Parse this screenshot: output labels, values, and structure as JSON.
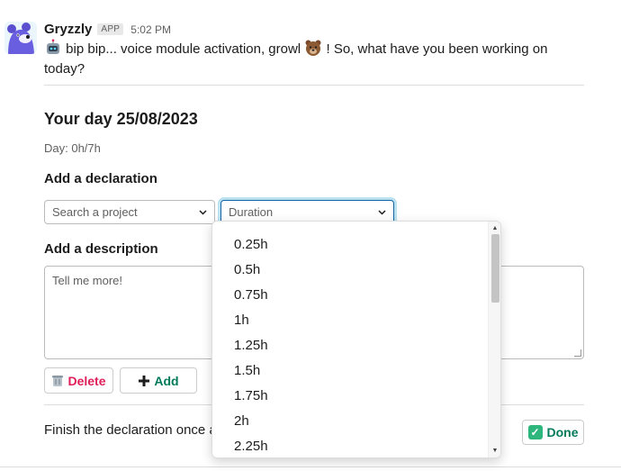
{
  "message": {
    "bot_name": "Gryzzly",
    "app_badge": "APP",
    "timestamp": "5:02 PM",
    "text_part1": " bip bip... voice module activation, growl ",
    "text_part2": " ! So, what have you been working on today?",
    "emoji_robot": "robot-emoji",
    "emoji_bear": "bear-emoji"
  },
  "form": {
    "day_title": "Your day 25/08/2023",
    "day_counter": "Day: 0h/7h",
    "declaration_label": "Add a declaration",
    "project_placeholder": "Search a project",
    "duration_placeholder": "Duration",
    "description_label": "Add a description",
    "description_placeholder": "Tell me more!",
    "delete_label": "Delete",
    "add_label": "Add",
    "finish_text": "Finish the declaration once a",
    "done_label": "Done"
  },
  "dropdown": {
    "options": [
      "0.25h",
      "0.5h",
      "0.75h",
      "1h",
      "1.25h",
      "1.5h",
      "1.75h",
      "2h",
      "2.25h"
    ]
  },
  "colors": {
    "delete": "#e01e5a",
    "add": "#007a5a",
    "focus": "#1264a3"
  }
}
